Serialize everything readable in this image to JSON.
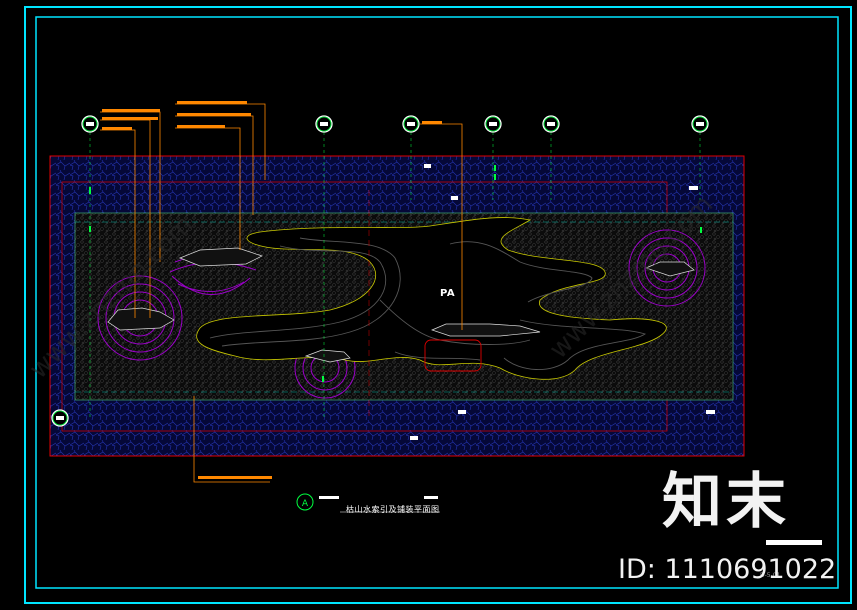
{
  "plan": {
    "area_label": "PA",
    "title": "枯山水索引及铺装平面图",
    "title_marker": "A",
    "drawing_code": "D-5-01"
  },
  "watermark": {
    "logo": "知末",
    "id_text": "ID: 1110691022",
    "diagonal_text": "www.znzmo.com"
  },
  "colors": {
    "frame": "#00e5ff",
    "boundary": "#e00000",
    "leader": "#ff8800",
    "gravel": "#3a3a3a",
    "paving_blue": "#1a2a9a",
    "ripple": "#9a00c8",
    "edge": "#c8c800"
  },
  "icons": [
    "grid-axis-marker-icon",
    "section-marker-icon"
  ]
}
